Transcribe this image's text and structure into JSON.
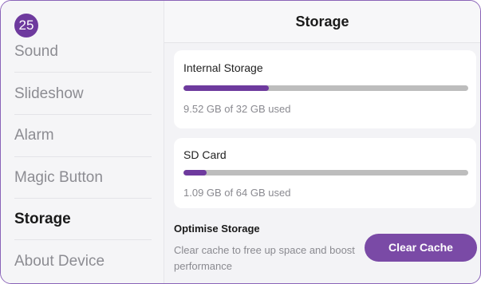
{
  "badge": {
    "count": "25"
  },
  "header": {
    "title": "Storage"
  },
  "sidebar": {
    "items": [
      {
        "label": "Sound",
        "active": false
      },
      {
        "label": "Slideshow",
        "active": false
      },
      {
        "label": "Alarm",
        "active": false
      },
      {
        "label": "Magic Button",
        "active": false
      },
      {
        "label": "Storage",
        "active": true
      },
      {
        "label": "About Device",
        "active": false
      }
    ]
  },
  "storage": {
    "internal": {
      "title": "Internal Storage",
      "usage": "9.52 GB of 32 GB used",
      "fraction": 0.3
    },
    "sd": {
      "title": "SD Card",
      "usage": "1.09 GB of 64 GB used",
      "fraction": 0.08
    }
  },
  "optimise": {
    "title": "Optimise Storage",
    "description": "Clear cache to free up space and boost performance",
    "button_label": "Clear Cache"
  },
  "colors": {
    "accent": "#6e3a9e",
    "track": "#bdbdbd"
  }
}
